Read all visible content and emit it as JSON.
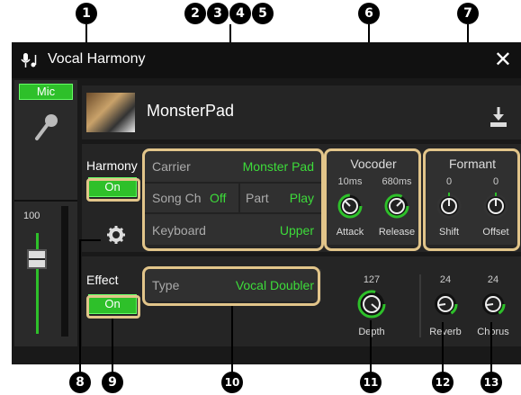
{
  "window": {
    "title": "Vocal Harmony",
    "close_label": "✕"
  },
  "mic": {
    "label": "Mic",
    "fader_value": "100"
  },
  "song": {
    "name": "MonsterPad"
  },
  "harmony": {
    "label": "Harmony",
    "toggle": "On"
  },
  "harmony_settings": {
    "carrier_label": "Carrier",
    "carrier_value": "Monster Pad",
    "songch_label": "Song Ch",
    "songch_value": "Off",
    "part_label": "Part",
    "part_value": "Play",
    "keyboard_label": "Keyboard",
    "keyboard_value": "Upper"
  },
  "vocoder": {
    "title": "Vocoder",
    "attack": {
      "label": "Attack",
      "value": "10ms"
    },
    "release": {
      "label": "Release",
      "value": "680ms"
    }
  },
  "formant": {
    "title": "Formant",
    "shift": {
      "label": "Shift",
      "value": "0"
    },
    "offset": {
      "label": "Offset",
      "value": "0"
    }
  },
  "effect": {
    "label": "Effect",
    "toggle": "On",
    "type_label": "Type",
    "type_value": "Vocal Doubler",
    "depth": {
      "label": "Depth",
      "value": "127"
    },
    "reverb": {
      "label": "Reverb",
      "value": "24"
    },
    "chorus": {
      "label": "Chorus",
      "value": "24"
    }
  },
  "callouts": [
    "1",
    "2",
    "3",
    "4",
    "5",
    "6",
    "7",
    "8",
    "9",
    "10",
    "11",
    "12",
    "13"
  ],
  "colors": {
    "accent": "#2ec02a",
    "value_green": "#3ddc3a",
    "highlight": "#e2c58a"
  }
}
